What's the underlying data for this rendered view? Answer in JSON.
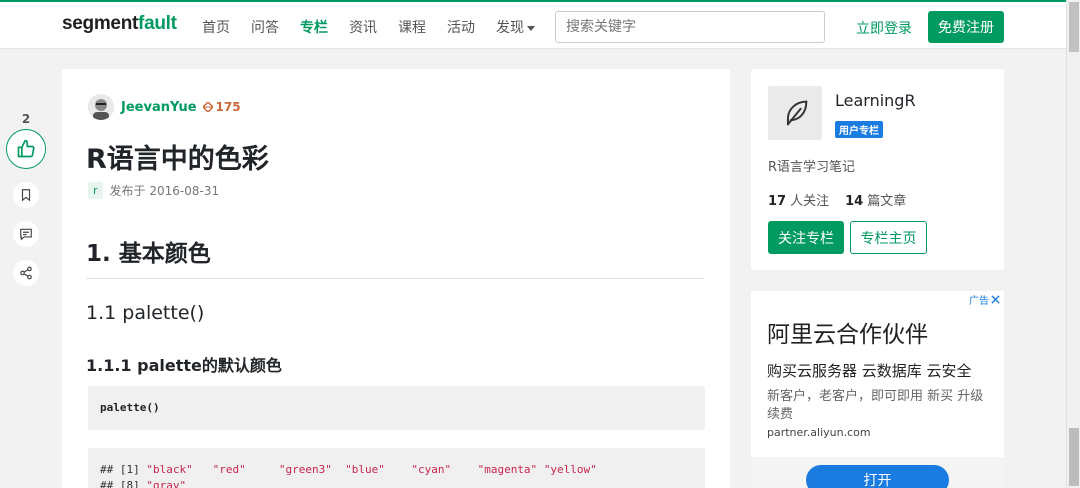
{
  "header": {
    "logo_main": "segment",
    "logo_accent": "fault",
    "nav": [
      "首页",
      "问答",
      "专栏",
      "资讯",
      "课程",
      "活动",
      "发现"
    ],
    "search_placeholder": "搜索关键字",
    "login": "立即登录",
    "signup": "免费注册"
  },
  "actions": {
    "like_count": "2"
  },
  "article": {
    "author": "JeevanYue",
    "reputation": "175",
    "title": "R语言中的色彩",
    "tag": "r",
    "published": "发布于 2016-08-31",
    "h1": "1. 基本颜色",
    "h2": "1.1 palette()",
    "h3": "1.1.1 palette的默认颜色",
    "code1": "palette()",
    "code2_prefix": "## [1] ",
    "code2_strings": [
      "\"black\"",
      "\"red\"",
      "\"green3\"",
      "\"blue\"",
      "\"cyan\"",
      "\"magenta\"",
      "\"yellow\""
    ],
    "code2_line2_prefix": "## [8] ",
    "code2_line2_string": "\"gray\""
  },
  "column": {
    "name": "LearningR",
    "badge": "用户专栏",
    "desc": "R语言学习笔记",
    "followers_num": "17",
    "followers_label": "人关注",
    "articles_num": "14",
    "articles_label": "篇文章",
    "follow_btn": "关注专栏",
    "home_btn": "专栏主页"
  },
  "ad": {
    "label": "广告",
    "title": "阿里云合作伙伴",
    "sub": "购买云服务器 云数据库 云安全",
    "desc": "新客户，老客户，即可即用 新买 升级续费",
    "url": "partner.aliyun.com",
    "button": "打开"
  }
}
